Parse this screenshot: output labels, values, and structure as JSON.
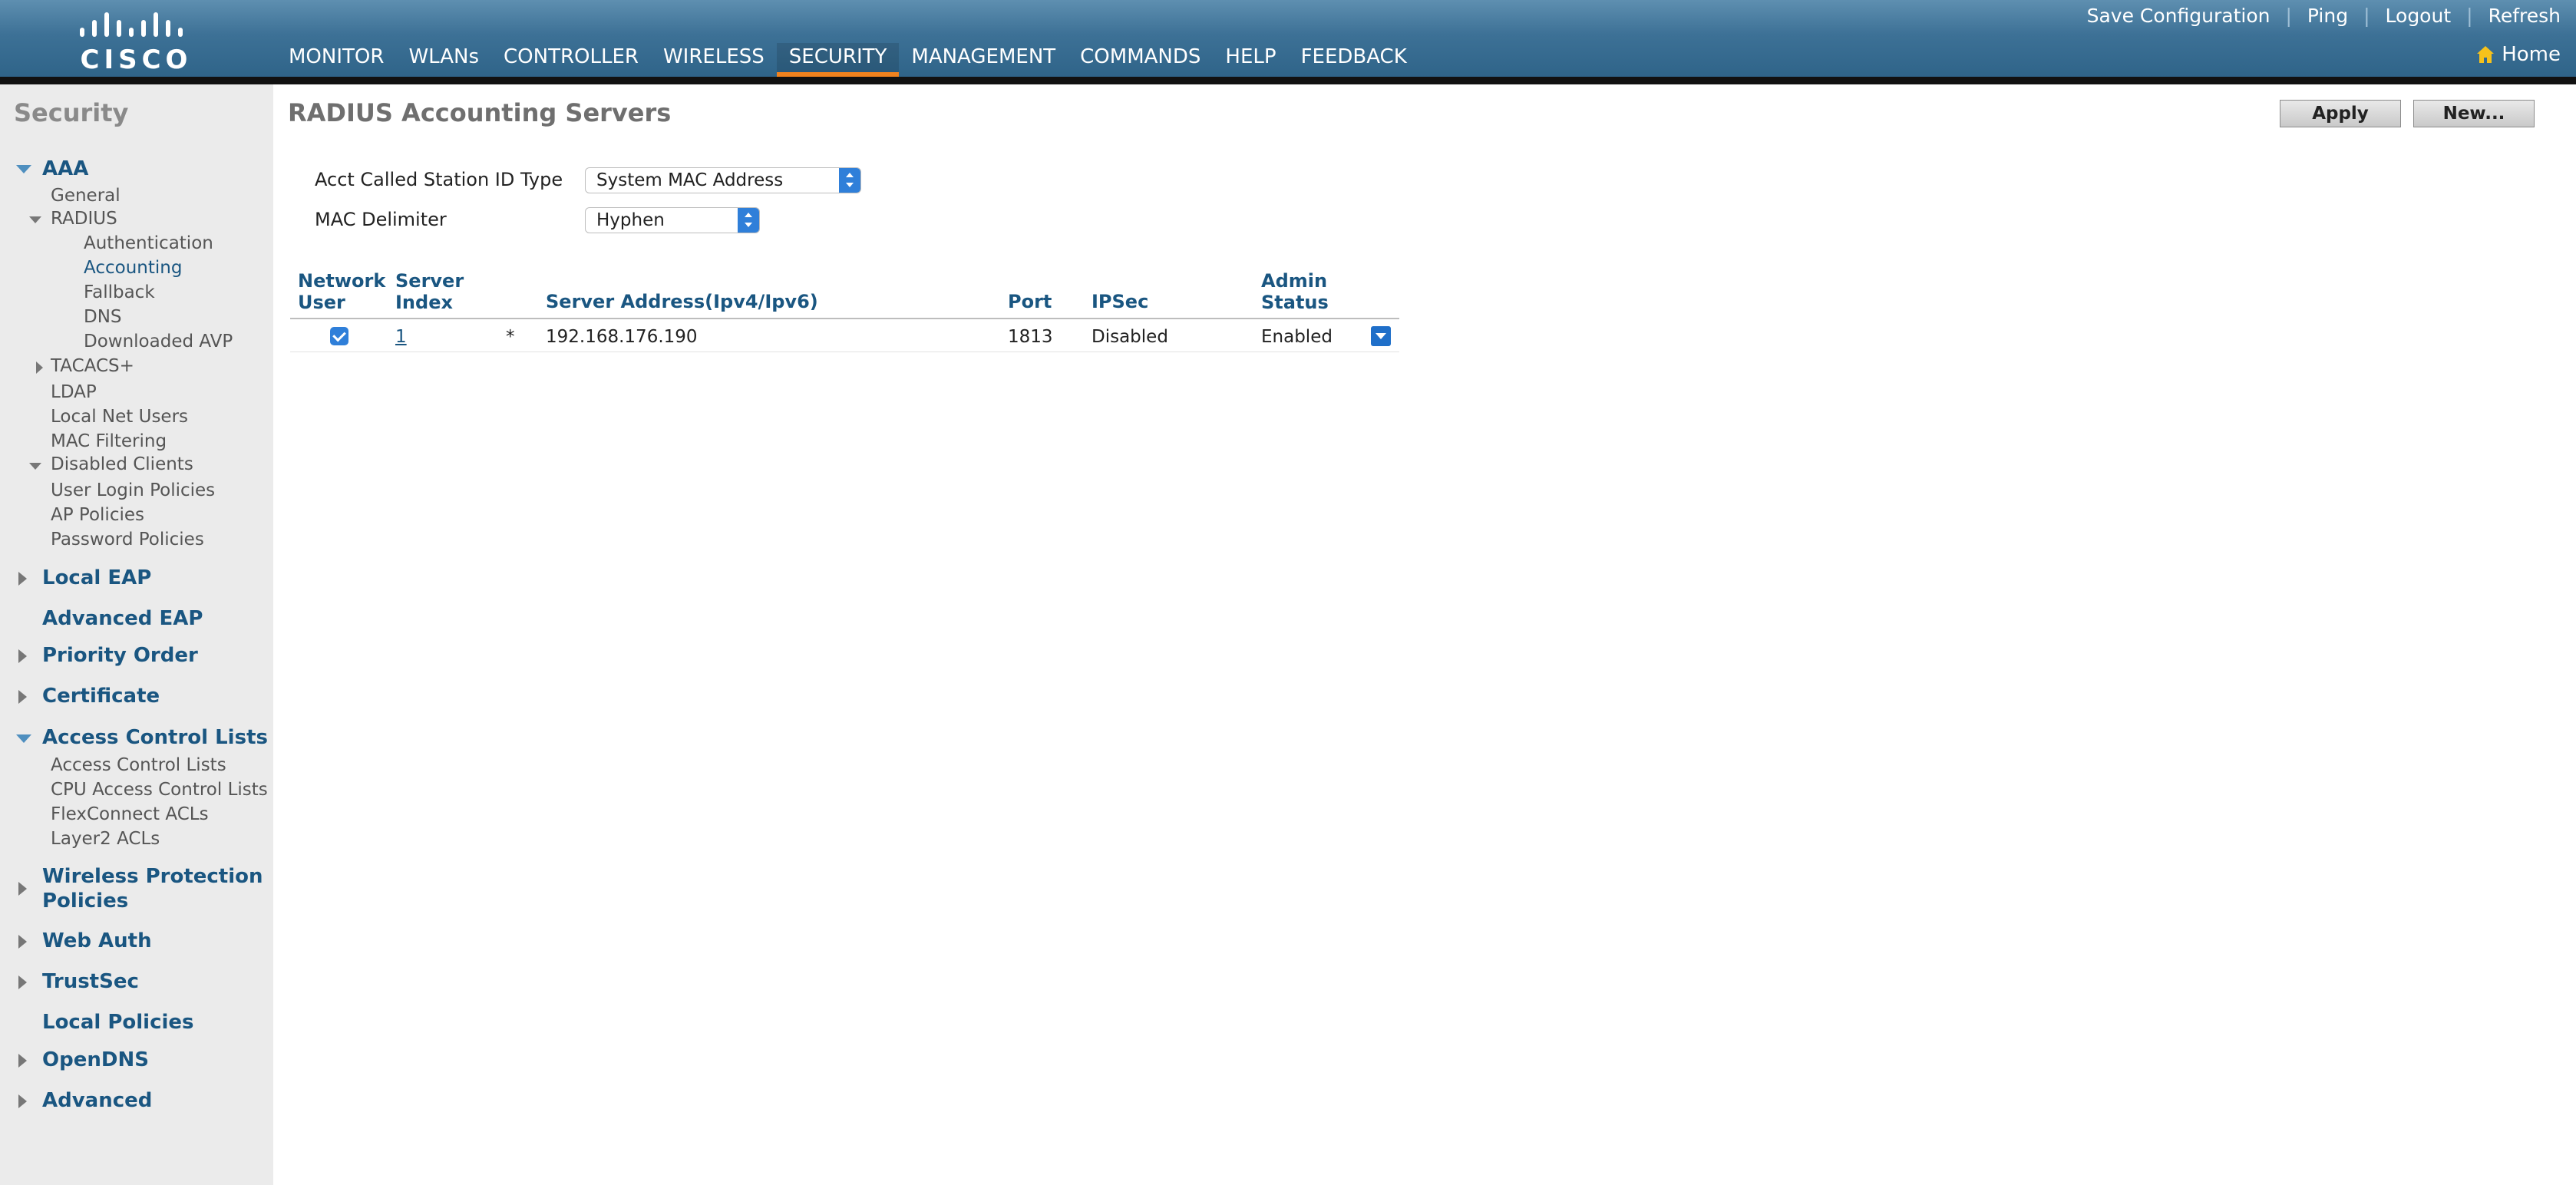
{
  "brand": {
    "logo_text": "CISCO"
  },
  "header": {
    "nav": [
      {
        "label": "MONITOR"
      },
      {
        "label": "WLANs"
      },
      {
        "label": "CONTROLLER"
      },
      {
        "label": "WIRELESS"
      },
      {
        "label": "SECURITY"
      },
      {
        "label": "MANAGEMENT"
      },
      {
        "label": "COMMANDS"
      },
      {
        "label": "HELP"
      },
      {
        "label": "FEEDBACK"
      }
    ],
    "active_nav": "SECURITY",
    "links": {
      "save": "Save Configuration",
      "ping": "Ping",
      "logout": "Logout",
      "refresh": "Refresh",
      "sep": "|"
    },
    "home": "Home"
  },
  "sidebar": {
    "title": "Security",
    "aaa": "AAA",
    "general": "General",
    "radius": "RADIUS",
    "authentication": "Authentication",
    "accounting": "Accounting",
    "fallback": "Fallback",
    "dns": "DNS",
    "downloaded_avp": "Downloaded AVP",
    "tacacs": "TACACS+",
    "ldap": "LDAP",
    "local_net_users": "Local Net Users",
    "mac_filtering": "MAC Filtering",
    "disabled_clients": "Disabled Clients",
    "user_login_policies": "User Login Policies",
    "ap_policies": "AP Policies",
    "password_policies": "Password Policies",
    "local_eap": "Local EAP",
    "advanced_eap": "Advanced EAP",
    "priority_order": "Priority Order",
    "certificate": "Certificate",
    "acl": "Access Control Lists",
    "acl_sub": "Access Control Lists",
    "cpu_acl": "CPU Access Control Lists",
    "flexconnect_acls": "FlexConnect ACLs",
    "layer2_acls": "Layer2 ACLs",
    "wpp_line1": "Wireless Protection",
    "wpp_line2": "Policies",
    "web_auth": "Web Auth",
    "trustsec": "TrustSec",
    "local_policies": "Local Policies",
    "opendns": "OpenDNS",
    "advanced": "Advanced"
  },
  "main": {
    "title": "RADIUS Accounting Servers",
    "apply": "Apply",
    "new": "New...",
    "acct_label": "Acct Called Station ID Type",
    "acct_value": "System MAC Address",
    "mac_label": "MAC Delimiter",
    "mac_value": "Hyphen",
    "table": {
      "h_network_1": "Network",
      "h_network_2": "User",
      "h_server_1": "Server",
      "h_server_2": "Index",
      "h_address": "Server Address(Ipv4/Ipv6)",
      "h_port": "Port",
      "h_ipsec": "IPSec",
      "h_admin_1": "Admin",
      "h_admin_2": "Status",
      "row": {
        "network_user": true,
        "index": "1",
        "marker": "*",
        "address": "192.168.176.190",
        "port": "1813",
        "ipsec": "Disabled",
        "admin": "Enabled"
      }
    }
  },
  "colors": {
    "header": "#3d7196",
    "accent": "#f0821e",
    "link": "#1a5681",
    "sidebar_bg": "#ebebeb"
  }
}
